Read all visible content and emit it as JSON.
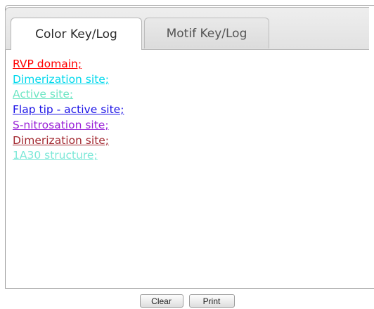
{
  "tabs": {
    "active_label": "Color Key/Log",
    "inactive_label": "Motif Key/Log"
  },
  "entries": [
    {
      "label": "RVP domain;",
      "color": "#ff0000"
    },
    {
      "label": "Dimerization site;",
      "color": "#00d8ec"
    },
    {
      "label": "Active site;",
      "color": "#6ee6c4"
    },
    {
      "label": "Flap tip - active site;",
      "color": "#1a11e6"
    },
    {
      "label": "S-nitrosation site;",
      "color": "#9b24d8"
    },
    {
      "label": "Dimerization site;",
      "color": "#a32a32"
    },
    {
      "label": "1A30 structure;",
      "color": "#7de8d8"
    }
  ],
  "buttons": {
    "clear_label": "Clear",
    "print_label": "Print"
  }
}
